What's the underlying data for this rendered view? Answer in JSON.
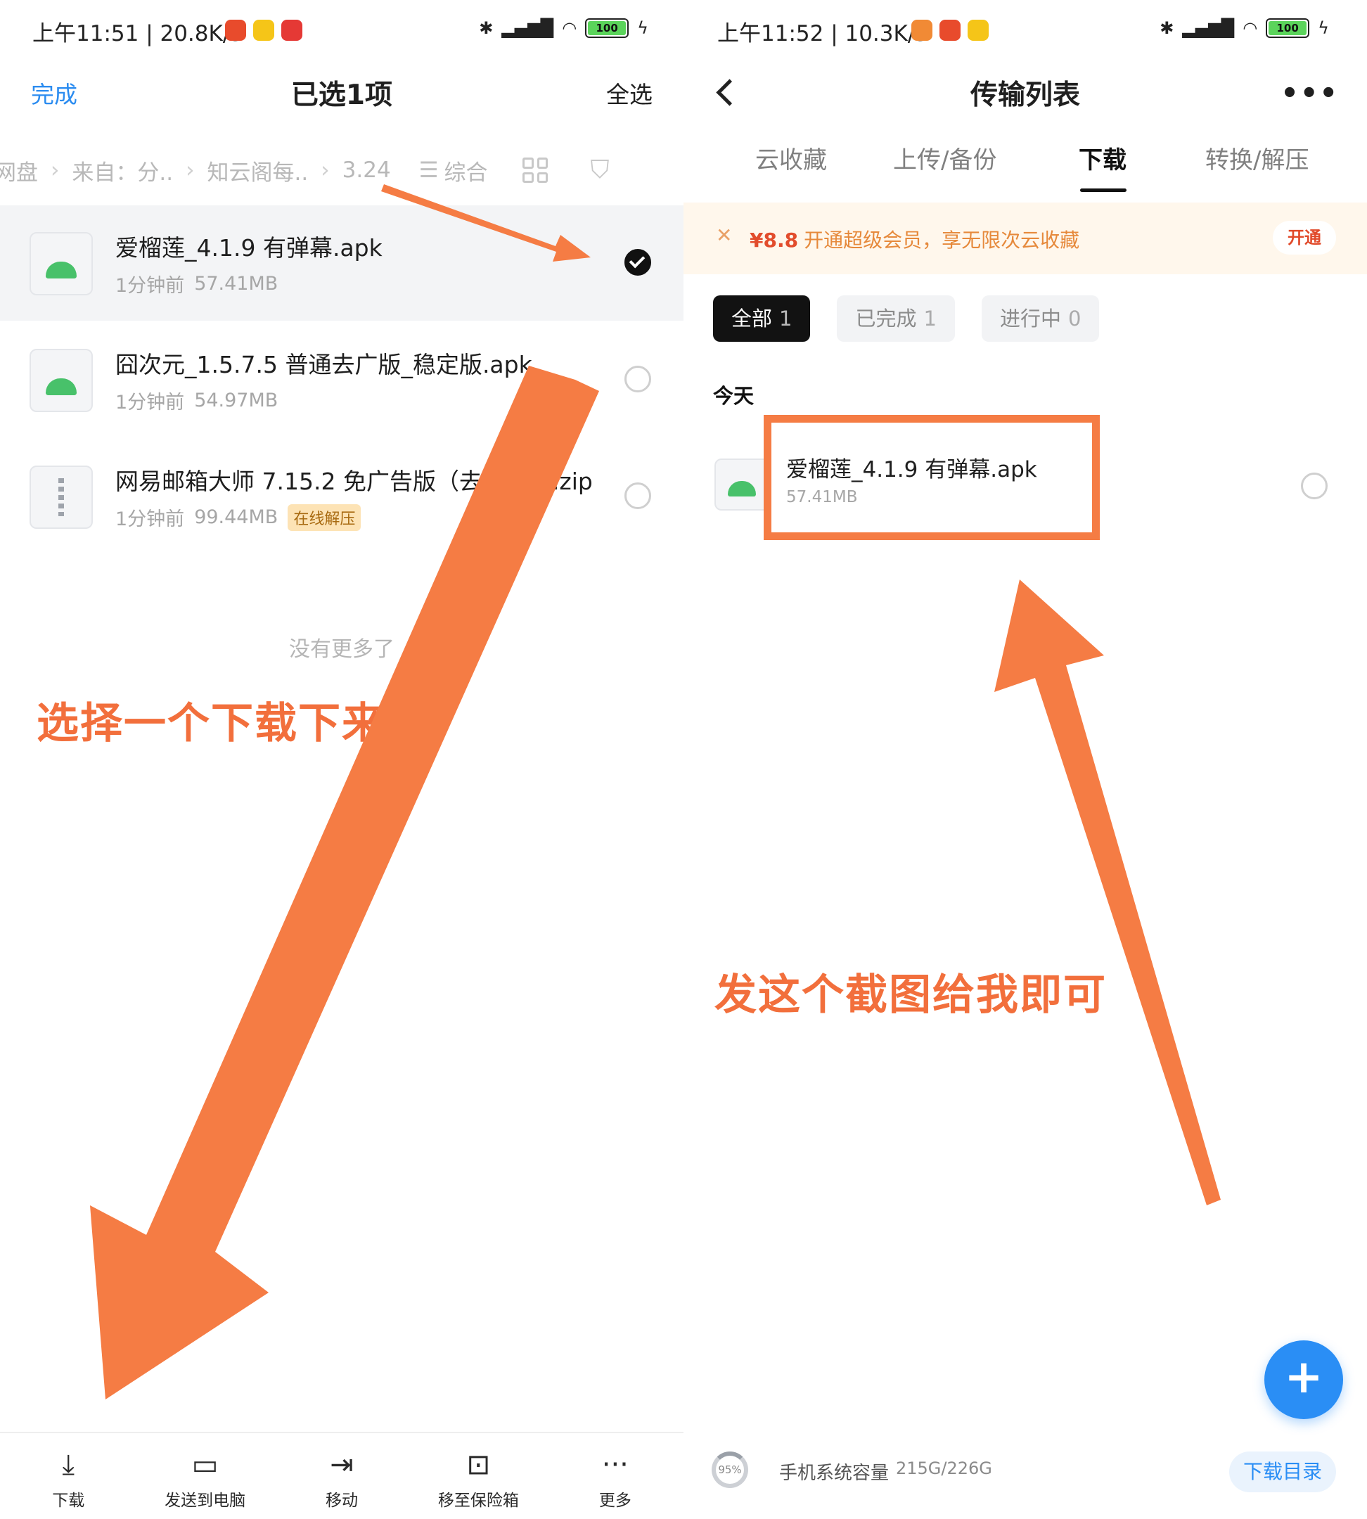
{
  "left": {
    "status": {
      "time": "上午11:51 | 20.8K/s",
      "battery": "100"
    },
    "nav": {
      "left_label": "完成",
      "title": "已选1项",
      "right_label": "全选"
    },
    "breadcrumbs": [
      "网盘",
      "来自：分..",
      "知云阁每..",
      "3.24"
    ],
    "sort_label": "综合",
    "files": [
      {
        "name": "爱榴莲_4.1.9 有弹幕.apk",
        "time": "1分钟前",
        "size": "57.41MB",
        "selected": true,
        "type": "apk",
        "tag": ""
      },
      {
        "name": "囧次元_1.5.7.5 普通去广版_稳定版.apk",
        "time": "1分钟前",
        "size": "54.97MB",
        "selected": false,
        "type": "apk",
        "tag": ""
      },
      {
        "name": "网易邮箱大师 7.15.2 免广告版（去更新）.zip",
        "time": "1分钟前",
        "size": "99.44MB",
        "selected": false,
        "type": "zip",
        "tag": "在线解压"
      }
    ],
    "no_more": "没有更多了",
    "annotation": "选择一个下载下来",
    "toolbar": [
      {
        "label": "下载",
        "icon": "download-icon"
      },
      {
        "label": "发送到电脑",
        "icon": "send-to-pc-icon"
      },
      {
        "label": "移动",
        "icon": "move-icon"
      },
      {
        "label": "移至保险箱",
        "icon": "vault-icon"
      },
      {
        "label": "更多",
        "icon": "more-icon"
      }
    ]
  },
  "right": {
    "status": {
      "time": "上午11:52 | 10.3K/s",
      "battery": "100"
    },
    "nav": {
      "title": "传输列表"
    },
    "tabs": [
      "云收藏",
      "上传/备份",
      "下载",
      "转换/解压"
    ],
    "active_tab": 2,
    "promo": {
      "price": "¥8.8",
      "text": "开通超级会员，享无限次云收藏",
      "button": "开通"
    },
    "chips": [
      {
        "label": "全部",
        "count": "1",
        "active": true
      },
      {
        "label": "已完成",
        "count": "1",
        "active": false
      },
      {
        "label": "进行中",
        "count": "0",
        "active": false
      }
    ],
    "section": "今天",
    "download": {
      "name": "爱榴莲_4.1.9 有弹幕.apk",
      "size": "57.41MB"
    },
    "annotation": "发这个截图给我即可",
    "fab": "+",
    "storage": {
      "percent": "95%",
      "label": "手机系统容量",
      "value": "215G/226G",
      "button": "下载目录"
    }
  },
  "colors": {
    "accent": "#2b8cf0",
    "annotation": "#f57c44",
    "promo_text": "#e6893b"
  }
}
